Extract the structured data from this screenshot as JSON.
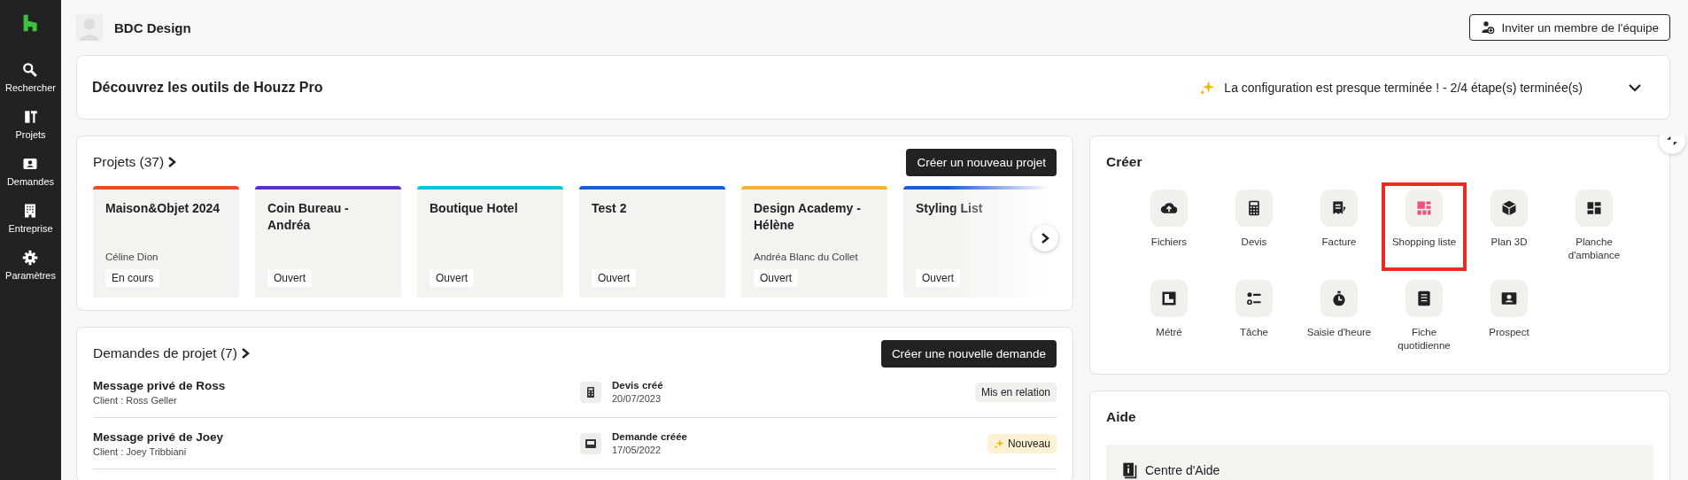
{
  "sidebar": {
    "items": [
      {
        "label": "Rechercher"
      },
      {
        "label": "Projets"
      },
      {
        "label": "Demandes"
      },
      {
        "label": "Entreprise"
      },
      {
        "label": "Paramètres"
      }
    ]
  },
  "header": {
    "company": "BDC Design",
    "invite_button": "Inviter un membre de l'équipe"
  },
  "setup_banner": {
    "title": "Découvrez les outils de Houzz Pro",
    "status": "La configuration est presque terminée ! - 2/4 étape(s) terminée(s)",
    "expanded": false
  },
  "projects": {
    "title": "Projets (37)",
    "create_button": "Créer un nouveau projet",
    "cards": [
      {
        "title": "Maison&Objet 2024",
        "client": "Céline Dion",
        "status": "En cours",
        "color": "#f04a2a"
      },
      {
        "title": "Coin Bureau - Andréa",
        "status": "Ouvert",
        "color": "#5b2fc9"
      },
      {
        "title": "Boutique Hotel",
        "status": "Ouvert",
        "color": "#12c2d6"
      },
      {
        "title": "Test 2",
        "status": "Ouvert",
        "color": "#1e5bd6"
      },
      {
        "title": "Design Academy - Hélène",
        "client": "Andréa Blanc du Collet",
        "status": "Ouvert",
        "color": "#f2b23a"
      },
      {
        "title": "Styling List",
        "status": "Ouvert",
        "color": "#1e5bd6"
      }
    ]
  },
  "requests": {
    "title": "Demandes de projet (7)",
    "create_button": "Créer une nouvelle demande",
    "rows": [
      {
        "title": "Message privé de Ross",
        "client": "Client : Ross Geller",
        "event": "Devis créé",
        "date": "20/07/2023",
        "badge": "Mis en relation",
        "kind": "plain"
      },
      {
        "title": "Message privé de Joey",
        "client": "Client : Joey Tribbiani",
        "event": "Demande créée",
        "date": "17/05/2022",
        "badge": "Nouveau",
        "kind": "new"
      }
    ]
  },
  "create": {
    "title": "Créer",
    "tools": [
      {
        "label": "Fichiers",
        "highlighted": false
      },
      {
        "label": "Devis",
        "highlighted": false
      },
      {
        "label": "Facture",
        "highlighted": false
      },
      {
        "label": "Shopping liste",
        "highlighted": true
      },
      {
        "label": "Plan 3D",
        "highlighted": false
      },
      {
        "label": "Planche d'ambiance",
        "highlighted": false
      },
      {
        "label": "Métré",
        "highlighted": false
      },
      {
        "label": "Tâche",
        "highlighted": false
      },
      {
        "label": "Saisie d'heure",
        "highlighted": false
      },
      {
        "label": "Fiche quotidienne",
        "highlighted": false
      },
      {
        "label": "Prospect",
        "highlighted": false
      }
    ]
  },
  "help": {
    "title": "Aide",
    "items": [
      {
        "label": "Centre d'Aide"
      }
    ]
  }
}
